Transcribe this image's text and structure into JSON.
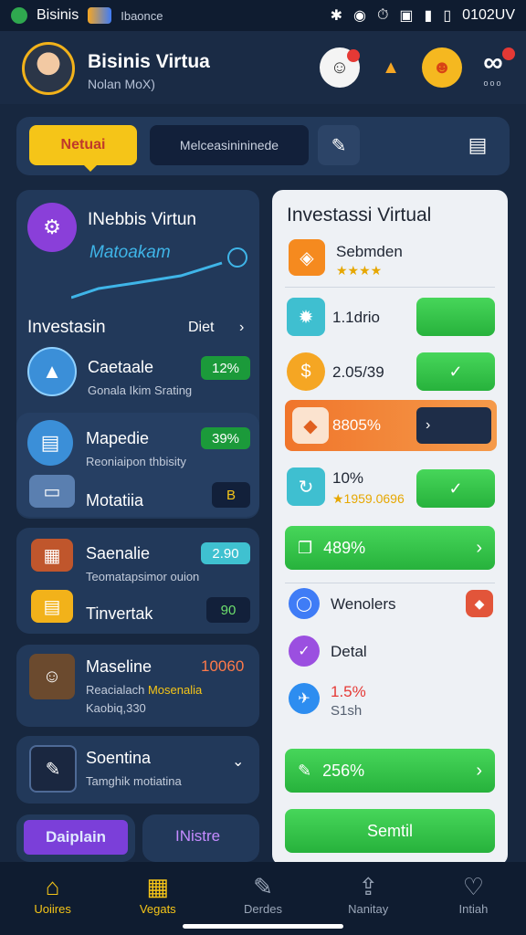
{
  "status": {
    "app_name": "Bisinis",
    "carrier": "Ibaonce",
    "time": "0102UV"
  },
  "header": {
    "title": "Bisinis Virtua",
    "subtitle": "Nolan MoX)",
    "badge_label": "ooo"
  },
  "toolbar": {
    "tab_label": "Netuai",
    "search_text": "Melceasinininede"
  },
  "left": {
    "hero_title": "INebbis Virtun",
    "hero_logo_text": "Matoakam",
    "section_title": "Investasin",
    "section_link": "Diet",
    "items": [
      {
        "title": "Caetaale",
        "sub": "Gonala Ikim Srating",
        "badge": "12%"
      },
      {
        "title": "Mapedie",
        "sub": "Reoniaipon thbisity",
        "badge": "39%"
      },
      {
        "title": "Motatiia",
        "badge": "B"
      },
      {
        "title": "Saenalie",
        "badge": "2.90",
        "sub": "Teomatapsimor ouion"
      },
      {
        "title": "Tinvertak",
        "badge": "90"
      },
      {
        "title": "Maseline",
        "badge": "10060",
        "sub": "Reacialach",
        "sub_highlight": "Mosenalia",
        "sub2": "Kaobiq,330"
      },
      {
        "title": "Soentina",
        "sub": "Tamghik motiatina"
      }
    ],
    "bottom_left": "Daiplain",
    "bottom_right": "INistre"
  },
  "right": {
    "title": "Investassi Virtual",
    "top_label": "Sebmden",
    "top_rating": "★★★★",
    "rows": [
      {
        "value": "1.1drio"
      },
      {
        "value": "2.05/39"
      },
      {
        "value": "8805%"
      },
      {
        "value": "10%",
        "sub": "★1959.0696"
      }
    ],
    "wide1": "489%",
    "list": [
      {
        "label": "Wenolers"
      },
      {
        "label": "Detal"
      },
      {
        "label": "1.5%",
        "sub": "S1sh"
      }
    ],
    "wide2": "256%",
    "submit": "Semtil"
  },
  "nav": [
    {
      "label": "Uoiires"
    },
    {
      "label": "Vegats"
    },
    {
      "label": "Derdes"
    },
    {
      "label": "Nanitay"
    },
    {
      "label": "Intiah"
    }
  ],
  "colors": {
    "accent": "#f5c518",
    "green": "#2fbf45",
    "orange": "#f07f2c",
    "panel": "#22395a"
  }
}
